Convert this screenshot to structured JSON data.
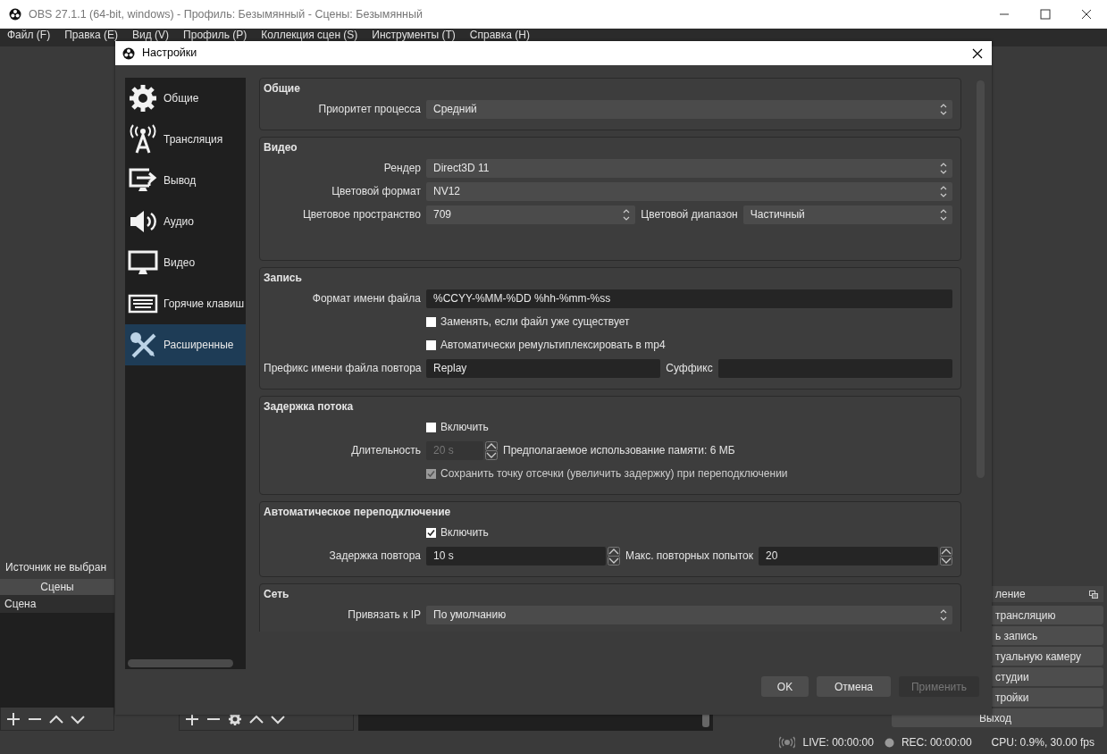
{
  "window": {
    "title": "OBS 27.1.1 (64-bit, windows) - Профиль: Безымянный - Сцены: Безымянный",
    "menu": [
      "Файл (F)",
      "Правка (E)",
      "Вид (V)",
      "Профиль (P)",
      "Коллекция сцен (S)",
      "Инструменты (T)",
      "Справка (H)"
    ]
  },
  "main": {
    "source_status": "Источник не выбран",
    "scenes": {
      "header": "Сцены",
      "items": [
        {
          "label": "Сцена",
          "selected": true
        }
      ]
    },
    "controls": {
      "header": "ление",
      "buttons": [
        "трансляцию",
        "ь запись",
        "туальную камеру",
        "студии",
        "тройки",
        "Выход"
      ]
    },
    "status_bar": {
      "live": "LIVE: 00:00:00",
      "rec": "REC: 00:00:00",
      "cpu": "CPU: 0.9%, 30.00 fps"
    }
  },
  "dialog": {
    "title": "Настройки",
    "sidebar": [
      {
        "label": "Общие",
        "selected": false
      },
      {
        "label": "Трансляция",
        "selected": false
      },
      {
        "label": "Вывод",
        "selected": false
      },
      {
        "label": "Аудио",
        "selected": false
      },
      {
        "label": "Видео",
        "selected": false
      },
      {
        "label": "Горячие клавиш",
        "selected": false
      },
      {
        "label": "Расширенные",
        "selected": true
      }
    ],
    "sections": [
      {
        "title": "Общие",
        "rows": [
          {
            "kind": "combo",
            "label": "Приоритет процесса",
            "value": "Средний",
            "disabled": false
          }
        ]
      },
      {
        "title": "Видео",
        "rows": [
          {
            "kind": "combo",
            "label": "Рендер",
            "value": "Direct3D 11",
            "disabled": false
          },
          {
            "kind": "combo",
            "label": "Цветовой формат",
            "value": "NV12",
            "disabled": false
          },
          {
            "kind": "pair",
            "fields": [
              {
                "kind": "combo",
                "label": "Цветовое пространство",
                "value": "709",
                "disabled": false
              },
              {
                "kind": "combo",
                "label": "Цветовой диапазон",
                "value": "Частичный",
                "disabled": false
              }
            ]
          }
        ]
      },
      {
        "title": "Запись",
        "rows": [
          {
            "kind": "text",
            "label": "Формат имени файла",
            "value": "%CCYY-%MM-%DD %hh-%mm-%ss",
            "disabled": false
          },
          {
            "kind": "check",
            "label": "Заменять, если файл уже существует",
            "checked": false,
            "disabled": false
          },
          {
            "kind": "check",
            "label": "Автоматически ремультиплексировать в mp4",
            "checked": false,
            "disabled": false
          },
          {
            "kind": "pair",
            "fields": [
              {
                "kind": "text",
                "label": "Префикс имени файла повтора",
                "value": "Replay",
                "disabled": false
              },
              {
                "kind": "text",
                "label": "Суффикс",
                "disabled": false
              }
            ]
          }
        ]
      },
      {
        "title": "Задержка потока",
        "rows": [
          {
            "kind": "check",
            "label": "Включить",
            "checked": false,
            "disabled": false
          },
          {
            "kind": "spin",
            "label": "Длительность",
            "value": "20 s",
            "disabled": true,
            "note": "Предполагаемое использование памяти: 6 МБ"
          },
          {
            "kind": "check",
            "label": "Сохранить точку отсечки (увеличить задержку) при переподключении",
            "checked": true,
            "disabled": true
          }
        ]
      },
      {
        "title": "Автоматическое переподключение",
        "rows": [
          {
            "kind": "check",
            "label": "Включить",
            "checked": true,
            "disabled": false
          },
          {
            "kind": "pair",
            "fields": [
              {
                "kind": "spin",
                "label": "Задержка повтора",
                "value": "10 s",
                "disabled": false
              },
              {
                "kind": "spin",
                "label": "Макс. повторных попыток",
                "value": "20",
                "disabled": false
              }
            ]
          }
        ]
      },
      {
        "title": "Сеть",
        "rows": [
          {
            "kind": "combo",
            "label": "Привязать к IP",
            "value": "По умолчанию",
            "disabled": false
          }
        ]
      }
    ],
    "buttons": [
      {
        "label": "OK",
        "disabled": false
      },
      {
        "label": "Отмена",
        "disabled": false
      },
      {
        "label": "Применить",
        "disabled": true
      }
    ]
  }
}
